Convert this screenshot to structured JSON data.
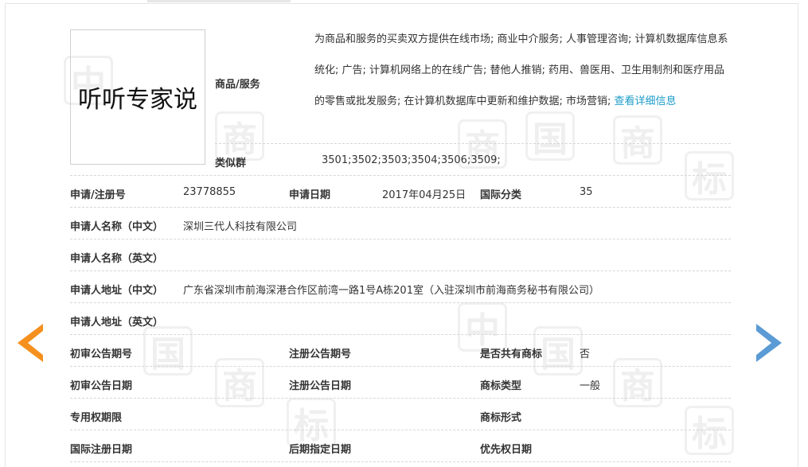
{
  "trademark": {
    "logo_text": "听听专家说",
    "goods_label": "商品/服务",
    "goods_text": "为商品和服务的买卖双方提供在线市场; 商业中介服务; 人事管理咨询; 计算机数据库信息系统化; 广告; 计算机网络上的在线广告; 替他人推销; 药用、兽医用、卫生用制剂和医疗用品的零售或批发服务; 在计算机数据库中更新和维护数据; 市场营销; ",
    "goods_more_link": "查看详细信息",
    "similar_label": "类似群",
    "similar_value": "3501;3502;3503;3504;3506;3509;"
  },
  "rows": {
    "reg_no_label": "申请/注册号",
    "reg_no_value": "23778855",
    "apply_date_label": "申请日期",
    "apply_date_value": "2017年04月25日",
    "intl_class_label": "国际分类",
    "intl_class_value": "35",
    "applicant_cn_label": "申请人名称（中文）",
    "applicant_cn_value": "深圳三代人科技有限公司",
    "applicant_en_label": "申请人名称（英文）",
    "address_cn_label": "申请人地址（中文）",
    "address_cn_value": "广东省深圳市前海深港合作区前湾一路1号A栋201室（入驻深圳市前海商务秘书有限公司）",
    "address_en_label": "申请人地址（英文）",
    "prelim_pub_no_label": "初审公告期号",
    "reg_pub_no_label": "注册公告期号",
    "shared_label": "是否共有商标",
    "shared_value": "否",
    "prelim_pub_date_label": "初审公告日期",
    "reg_pub_date_label": "注册公告日期",
    "tm_type_label": "商标类型",
    "tm_type_value": "一般",
    "exclusive_period_label": "专用权期限",
    "tm_form_label": "商标形式",
    "intl_reg_date_label": "国际注册日期",
    "later_designation_label": "后期指定日期",
    "priority_date_label": "优先权日期"
  },
  "nav": {
    "prev_icon": "arrow-left-icon",
    "next_icon": "arrow-right-icon",
    "prev_color": "#f5901e",
    "next_color": "#5b9bd5"
  },
  "watermark_chars": [
    "商",
    "标",
    "中",
    "国"
  ]
}
